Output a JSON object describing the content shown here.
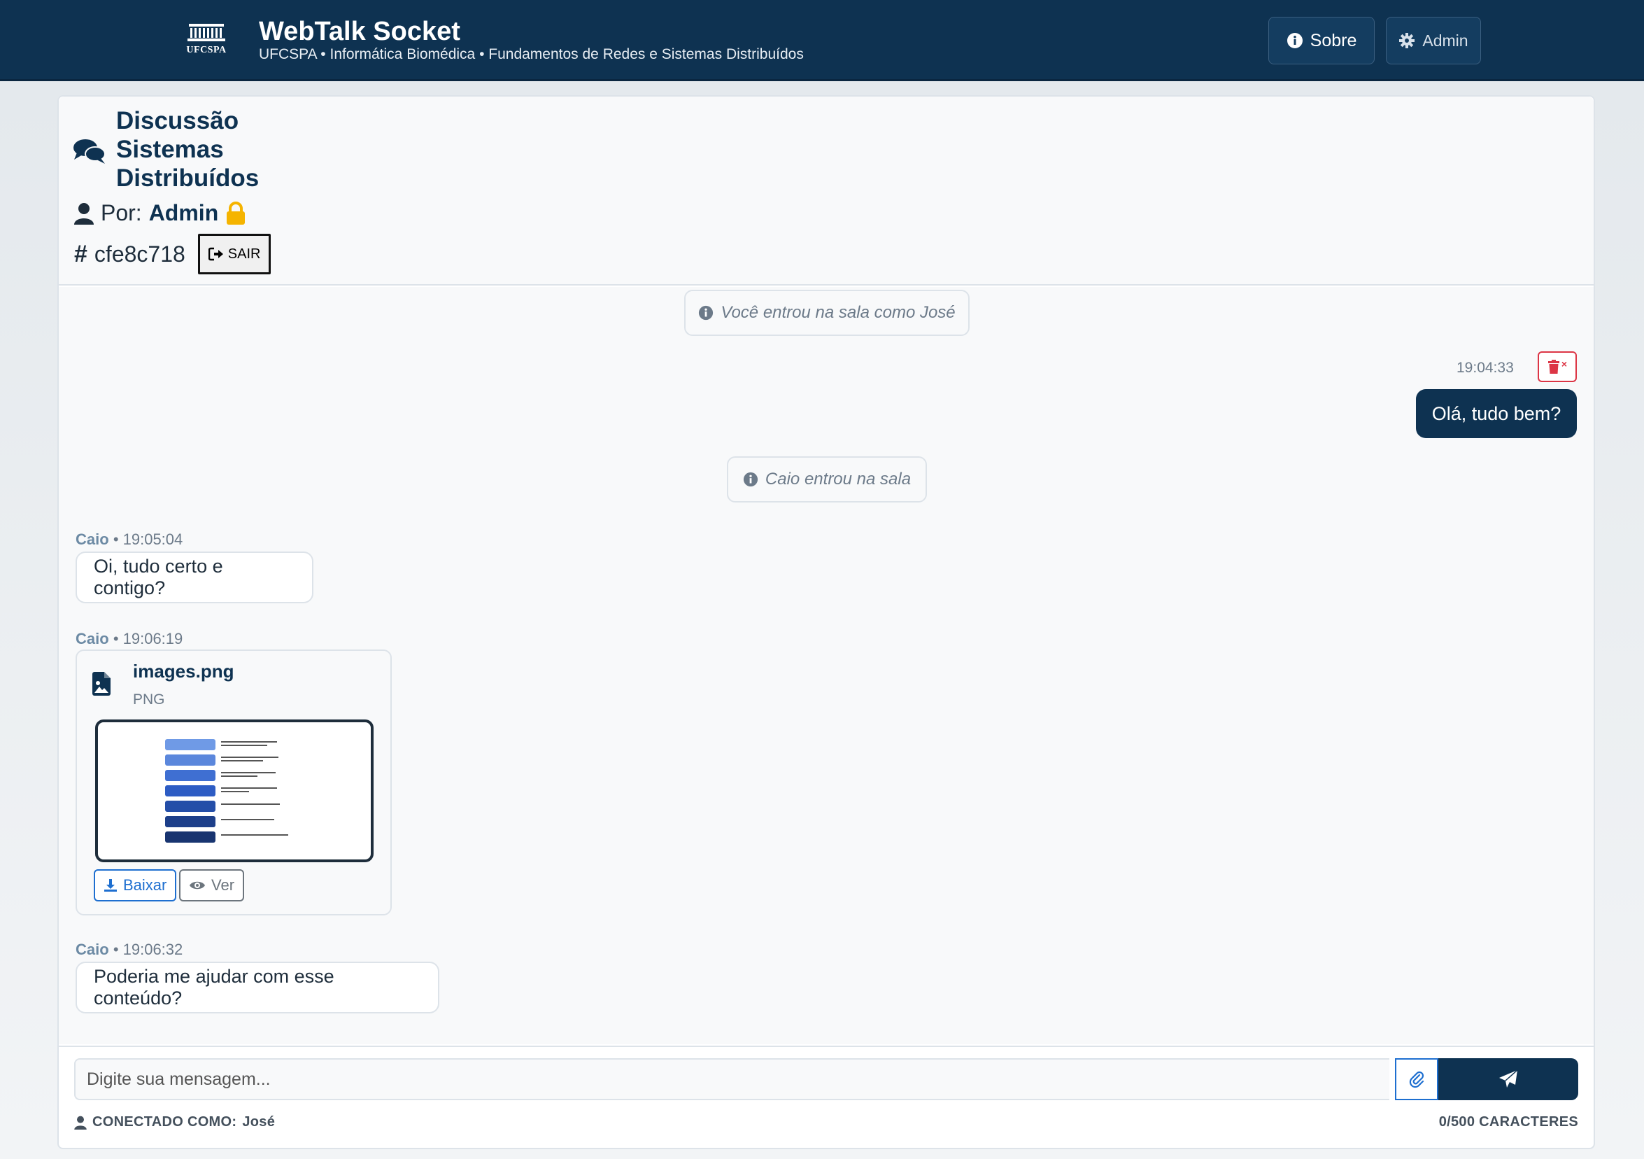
{
  "header": {
    "logo_text": "UFCSPA",
    "title": "WebTalk Socket",
    "subtitle": "UFCSPA • Informática Biomédica • Fundamentos de Redes e Sistemas Distribuídos",
    "sobre_label": "Sobre",
    "admin_label": "Admin"
  },
  "room": {
    "title": "Discussão Sistemas Distribuídos",
    "author_prefix": "Por:",
    "author": "Admin",
    "id": "cfe8c718",
    "exit_label": "SAIR"
  },
  "messages": {
    "system_join_self": "Você entrou na sala como José",
    "own_time": "19:04:33",
    "own_text": "Olá, tudo bem?",
    "system_join_other": "Caio entrou na sala",
    "msg1": {
      "author": "Caio",
      "time": "• 19:05:04",
      "text": "Oi, tudo certo e contigo?"
    },
    "msg2": {
      "author": "Caio",
      "time": "• 19:06:19",
      "file_name": "images.png",
      "file_type": "PNG",
      "download_label": "Baixar",
      "view_label": "Ver"
    },
    "msg3": {
      "author": "Caio",
      "time": "• 19:06:32",
      "text": "Poderia me ajudar com esse conteúdo?"
    }
  },
  "composer": {
    "placeholder": "Digite sua mensagem...",
    "connected_label": "CONECTADO COMO:",
    "connected_user": "José",
    "char_count": "0/500 CARACTERES"
  },
  "colors": {
    "primary": "#0e3251",
    "danger": "#dc3545",
    "link": "#1e6fd0",
    "lock": "#f5b400"
  }
}
